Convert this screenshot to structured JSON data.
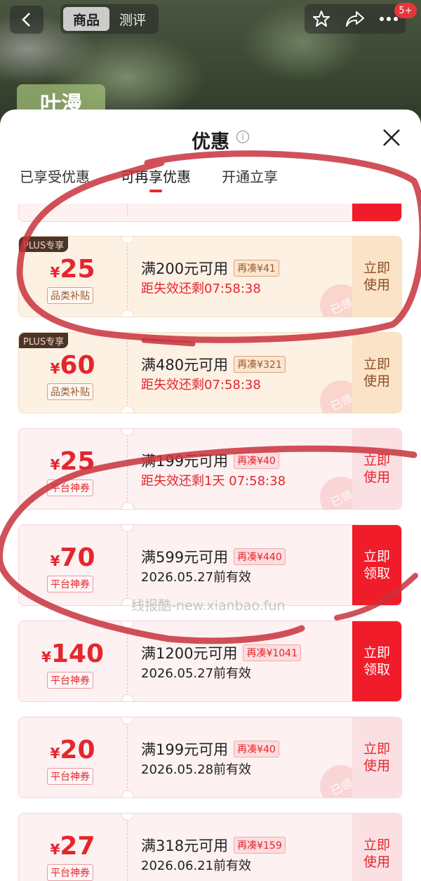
{
  "header": {
    "tabs": [
      {
        "label": "商品"
      },
      {
        "label": "测评"
      }
    ],
    "badge": "5+",
    "brand_tag": "叶漫"
  },
  "sheet": {
    "title": "优惠",
    "tabs": [
      {
        "label": "已享受优惠"
      },
      {
        "label": "可再享优惠"
      },
      {
        "label": "开通立享"
      }
    ]
  },
  "coupons": [
    {
      "badge": "PLUS专享",
      "currency": "¥",
      "amount": "25",
      "tag": "品类补贴",
      "condition": "满200元可用",
      "extra": "再凑¥41",
      "sub": "距失效还剩07:58:38",
      "action": "立即\n使用",
      "stamp": "已领"
    },
    {
      "badge": "PLUS专享",
      "currency": "¥",
      "amount": "60",
      "tag": "品类补贴",
      "condition": "满480元可用",
      "extra": "再凑¥321",
      "sub": "距失效还剩07:58:38",
      "action": "立即\n使用",
      "stamp": "已领"
    },
    {
      "currency": "¥",
      "amount": "25",
      "tag": "平台神券",
      "condition": "满199元可用",
      "extra": "再凑¥40",
      "sub": "距失效还剩1天 07:58:38",
      "action": "立即\n使用",
      "stamp": "已领"
    },
    {
      "currency": "¥",
      "amount": "70",
      "tag": "平台神券",
      "condition": "满599元可用",
      "extra": "再凑¥440",
      "sub": "2026.05.27前有效",
      "action": "立即\n领取"
    },
    {
      "currency": "¥",
      "amount": "140",
      "tag": "平台神券",
      "condition": "满1200元可用",
      "extra": "再凑¥1041",
      "sub": "2026.05.27前有效",
      "action": "立即\n领取"
    },
    {
      "currency": "¥",
      "amount": "20",
      "tag": "平台神券",
      "condition": "满199元可用",
      "extra": "再凑¥40",
      "sub": "2026.05.28前有效",
      "action": "立即\n使用",
      "stamp": "已领"
    },
    {
      "currency": "¥",
      "amount": "27",
      "tag": "平台神券",
      "condition": "满318元可用",
      "extra": "再凑¥159",
      "sub": "2026.06.21前有效",
      "action": "立即\n使用"
    }
  ],
  "watermark": "线报酷-new.xianbao.fun"
}
